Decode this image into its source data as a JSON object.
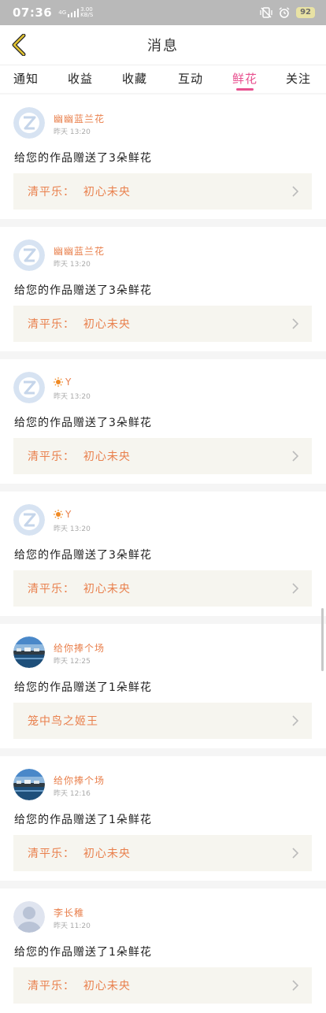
{
  "status_bar": {
    "time": "07:36",
    "network": "4G",
    "speed_value": "3.00",
    "speed_unit": "KB/S",
    "battery": "92"
  },
  "header": {
    "title": "消息"
  },
  "tabs": [
    {
      "label": "通知",
      "active": false
    },
    {
      "label": "收益",
      "active": false
    },
    {
      "label": "收藏",
      "active": false
    },
    {
      "label": "互动",
      "active": false
    },
    {
      "label": "鲜花",
      "active": true
    },
    {
      "label": "关注",
      "active": false
    }
  ],
  "messages": [
    {
      "sender": "幽幽蓝兰花",
      "time": "昨天 13:20",
      "text": "给您的作品赠送了3朵鲜花",
      "work": "清平乐：  初心未央",
      "avatar": "default-avatar",
      "sun": false
    },
    {
      "sender": "幽幽蓝兰花",
      "time": "昨天 13:20",
      "text": "给您的作品赠送了3朵鲜花",
      "work": "清平乐：  初心未央",
      "avatar": "default-avatar",
      "sun": false
    },
    {
      "sender": "Y",
      "time": "昨天 13:20",
      "text": "给您的作品赠送了3朵鲜花",
      "work": "清平乐：  初心未央",
      "avatar": "default-avatar",
      "sun": true
    },
    {
      "sender": "Y",
      "time": "昨天 13:20",
      "text": "给您的作品赠送了3朵鲜花",
      "work": "清平乐：  初心未央",
      "avatar": "default-avatar",
      "sun": true
    },
    {
      "sender": "给你捧个场",
      "time": "昨天 12:25",
      "text": "给您的作品赠送了1朵鲜花",
      "work": "笼中鸟之姬王",
      "avatar": "photo-avatar",
      "sun": false
    },
    {
      "sender": "给你捧个场",
      "time": "昨天 12:16",
      "text": "给您的作品赠送了1朵鲜花",
      "work": "清平乐：  初心未央",
      "avatar": "photo-avatar",
      "sun": false
    },
    {
      "sender": "李长稚",
      "time": "昨天 11:20",
      "text": "给您的作品赠送了1朵鲜花",
      "work": "清平乐：  初心未央",
      "avatar": "person-avatar",
      "sun": false
    }
  ],
  "colors": {
    "accent": "#e8508f",
    "sender": "#e9804d",
    "work_box_bg": "#f6f5ef"
  }
}
